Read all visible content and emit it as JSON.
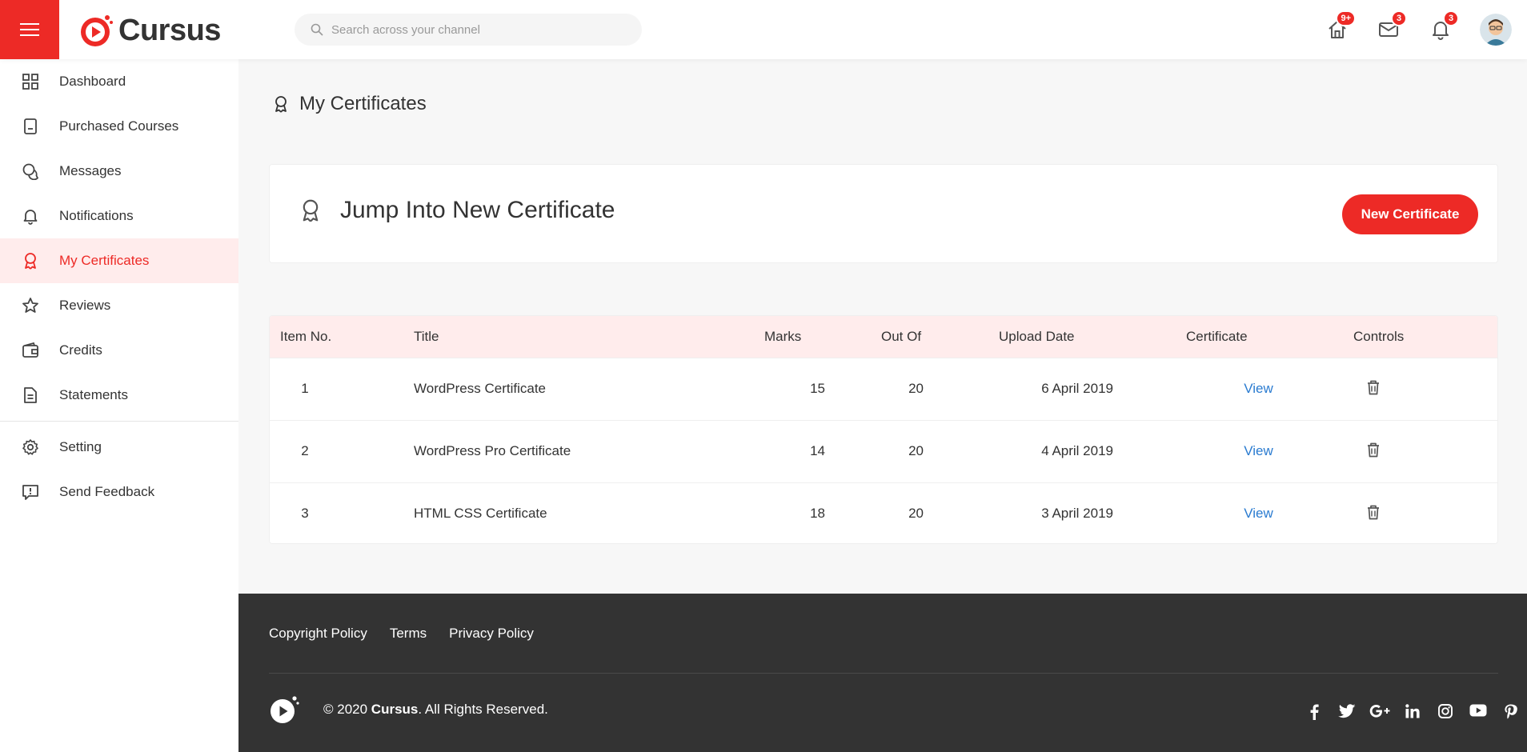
{
  "header": {
    "logo_text": "Cursus",
    "search_placeholder": "Search across your channel",
    "badges": {
      "home": "9+",
      "messages": "3",
      "notifications": "3"
    }
  },
  "sidebar": {
    "items": [
      {
        "label": "Dashboard",
        "icon": "grid-icon"
      },
      {
        "label": "Purchased Courses",
        "icon": "book-icon"
      },
      {
        "label": "Messages",
        "icon": "chat-icon"
      },
      {
        "label": "Notifications",
        "icon": "bell-icon"
      },
      {
        "label": "My Certificates",
        "icon": "award-icon",
        "active": true
      },
      {
        "label": "Reviews",
        "icon": "star-icon"
      },
      {
        "label": "Credits",
        "icon": "wallet-icon"
      },
      {
        "label": "Statements",
        "icon": "document-icon"
      },
      {
        "label": "Setting",
        "icon": "gear-icon"
      },
      {
        "label": "Send Feedback",
        "icon": "feedback-icon"
      }
    ]
  },
  "main": {
    "page_title": "My Certificates",
    "jump_card": {
      "title": "Jump Into New Certificate",
      "button_label": "New Certificate"
    },
    "table": {
      "headers": [
        "Item No.",
        "Title",
        "Marks",
        "Out Of",
        "Upload Date",
        "Certificate",
        "Controls"
      ],
      "rows": [
        {
          "no": "1",
          "title": "WordPress Certificate",
          "marks": "15",
          "out_of": "20",
          "date": "6 April 2019",
          "action": "View"
        },
        {
          "no": "2",
          "title": "WordPress Pro Certificate",
          "marks": "14",
          "out_of": "20",
          "date": "4 April 2019",
          "action": "View"
        },
        {
          "no": "3",
          "title": "HTML CSS Certificate",
          "marks": "18",
          "out_of": "20",
          "date": "3 April 2019",
          "action": "View"
        }
      ]
    }
  },
  "footer": {
    "links": [
      "Copyright Policy",
      "Terms",
      "Privacy Policy"
    ],
    "copyright_prefix": "© 2020 ",
    "copyright_brand": "Cursus",
    "copyright_suffix": ". All Rights Reserved.",
    "social": [
      "facebook-icon",
      "twitter-icon",
      "google-plus-icon",
      "linkedin-icon",
      "instagram-icon",
      "youtube-icon",
      "pinterest-icon"
    ]
  },
  "colors": {
    "accent": "#ed2a26",
    "active_bg": "#ffecec",
    "link": "#2a7bd0",
    "footer_bg": "#333333"
  }
}
